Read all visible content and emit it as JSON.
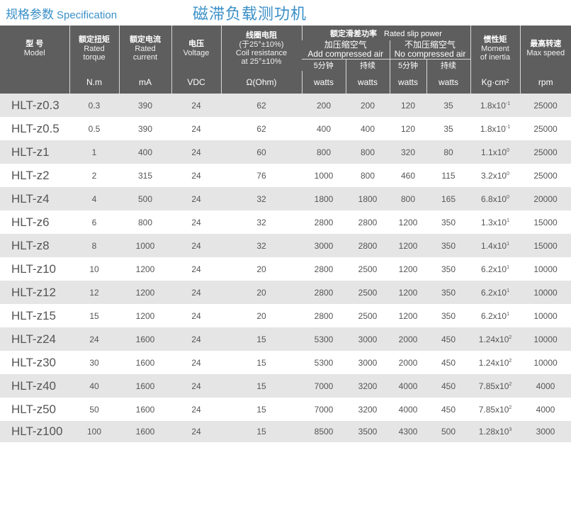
{
  "header": {
    "label_cn": "规格参数",
    "label_en": "Specification",
    "title": "磁滞负载测功机"
  },
  "table": {
    "columns": {
      "model": {
        "cn": "型 号",
        "en": "Model"
      },
      "torque": {
        "cn": "额定扭矩",
        "en1": "Rated",
        "en2": "torque"
      },
      "current": {
        "cn": "额定电流",
        "en1": "Rated",
        "en2": "current"
      },
      "voltage": {
        "cn": "电压",
        "en": "Voltage"
      },
      "resistance": {
        "cn": "线圈电阻",
        "line1": "(于25°±10%)",
        "line2": "Coil resistance",
        "line3": "at 25°±10%"
      },
      "slip": {
        "cn": "额定滑差功率",
        "en": "Rated slip power"
      },
      "add_air": {
        "cn": "加压缩空气",
        "en": "Add compressed air"
      },
      "no_air": {
        "cn": "不加压缩空气",
        "en": "No compressed air"
      },
      "min5": "5分钟",
      "continuous": "持续",
      "inertia": {
        "cn": "惯性矩",
        "en1": "Moment",
        "en2": "of inertia"
      },
      "speed": {
        "cn": "最高转速",
        "en": "Max speed"
      }
    },
    "units": [
      "N.m",
      "mA",
      "VDC",
      "Ω(Ohm)",
      "watts",
      "watts",
      "watts",
      "watts",
      "Kg·cm²",
      "rpm"
    ],
    "rows": [
      {
        "model": "HLT-z0.3",
        "torque": "0.3",
        "current": "390",
        "voltage": "24",
        "resistance": "62",
        "add5": "200",
        "addc": "200",
        "no5": "120",
        "noc": "35",
        "inertia_base": "1.8x10",
        "inertia_exp": "-1",
        "speed": "25000"
      },
      {
        "model": "HLT-z0.5",
        "torque": "0.5",
        "current": "390",
        "voltage": "24",
        "resistance": "62",
        "add5": "400",
        "addc": "400",
        "no5": "120",
        "noc": "35",
        "inertia_base": "1.8x10",
        "inertia_exp": "-1",
        "speed": "25000"
      },
      {
        "model": "HLT-z1",
        "torque": "1",
        "current": "400",
        "voltage": "24",
        "resistance": "60",
        "add5": "800",
        "addc": "800",
        "no5": "320",
        "noc": "80",
        "inertia_base": "1.1x10",
        "inertia_exp": "0",
        "speed": "25000"
      },
      {
        "model": "HLT-z2",
        "torque": "2",
        "current": "315",
        "voltage": "24",
        "resistance": "76",
        "add5": "1000",
        "addc": "800",
        "no5": "460",
        "noc": "115",
        "inertia_base": "3.2x10",
        "inertia_exp": "0",
        "speed": "25000"
      },
      {
        "model": "HLT-z4",
        "torque": "4",
        "current": "500",
        "voltage": "24",
        "resistance": "32",
        "add5": "1800",
        "addc": "1800",
        "no5": "800",
        "noc": "165",
        "inertia_base": "6.8x10",
        "inertia_exp": "0",
        "speed": "20000"
      },
      {
        "model": "HLT-z6",
        "torque": "6",
        "current": "800",
        "voltage": "24",
        "resistance": "32",
        "add5": "2800",
        "addc": "2800",
        "no5": "1200",
        "noc": "350",
        "inertia_base": "1.3x10",
        "inertia_exp": "1",
        "speed": "15000"
      },
      {
        "model": "HLT-z8",
        "torque": "8",
        "current": "1000",
        "voltage": "24",
        "resistance": "32",
        "add5": "3000",
        "addc": "2800",
        "no5": "1200",
        "noc": "350",
        "inertia_base": "1.4x10",
        "inertia_exp": "1",
        "speed": "15000"
      },
      {
        "model": "HLT-z10",
        "torque": "10",
        "current": "1200",
        "voltage": "24",
        "resistance": "20",
        "add5": "2800",
        "addc": "2500",
        "no5": "1200",
        "noc": "350",
        "inertia_base": "6.2x10",
        "inertia_exp": "1",
        "speed": "10000"
      },
      {
        "model": "HLT-z12",
        "torque": "12",
        "current": "1200",
        "voltage": "24",
        "resistance": "20",
        "add5": "2800",
        "addc": "2500",
        "no5": "1200",
        "noc": "350",
        "inertia_base": "6.2x10",
        "inertia_exp": "1",
        "speed": "10000"
      },
      {
        "model": "HLT-z15",
        "torque": "15",
        "current": "1200",
        "voltage": "24",
        "resistance": "20",
        "add5": "2800",
        "addc": "2500",
        "no5": "1200",
        "noc": "350",
        "inertia_base": "6.2x10",
        "inertia_exp": "1",
        "speed": "10000"
      },
      {
        "model": "HLT-z24",
        "torque": "24",
        "current": "1600",
        "voltage": "24",
        "resistance": "15",
        "add5": "5300",
        "addc": "3000",
        "no5": "2000",
        "noc": "450",
        "inertia_base": "1.24x10",
        "inertia_exp": "2",
        "speed": "10000"
      },
      {
        "model": "HLT-z30",
        "torque": "30",
        "current": "1600",
        "voltage": "24",
        "resistance": "15",
        "add5": "5300",
        "addc": "3000",
        "no5": "2000",
        "noc": "450",
        "inertia_base": "1.24x10",
        "inertia_exp": "2",
        "speed": "10000"
      },
      {
        "model": "HLT-z40",
        "torque": "40",
        "current": "1600",
        "voltage": "24",
        "resistance": "15",
        "add5": "7000",
        "addc": "3200",
        "no5": "4000",
        "noc": "450",
        "inertia_base": "7.85x10",
        "inertia_exp": "2",
        "speed": "4000"
      },
      {
        "model": "HLT-z50",
        "torque": "50",
        "current": "1600",
        "voltage": "24",
        "resistance": "15",
        "add5": "7000",
        "addc": "3200",
        "no5": "4000",
        "noc": "450",
        "inertia_base": "7.85x10",
        "inertia_exp": "2",
        "speed": "4000"
      },
      {
        "model": "HLT-z100",
        "torque": "100",
        "current": "1600",
        "voltage": "24",
        "resistance": "15",
        "add5": "8500",
        "addc": "3500",
        "no5": "4300",
        "noc": "500",
        "inertia_base": "1.28x10",
        "inertia_exp": "3",
        "speed": "3000"
      }
    ]
  }
}
